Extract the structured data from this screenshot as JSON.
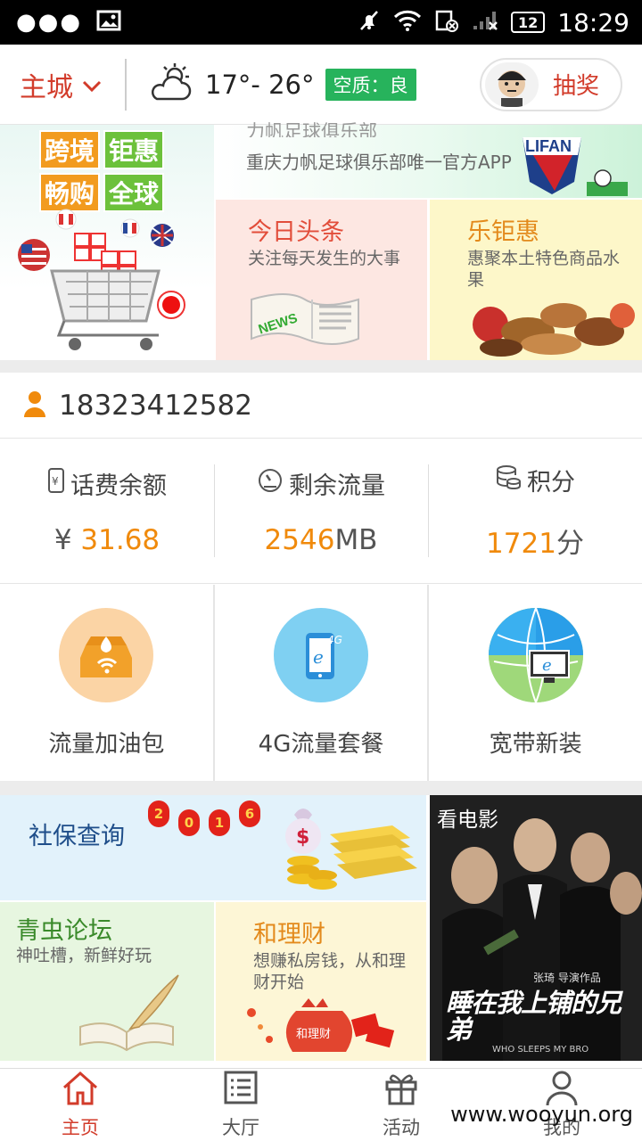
{
  "status_bar": {
    "time": "18:29",
    "battery": "12"
  },
  "header": {
    "city": "主城",
    "temperature": "17°- 26°",
    "air_quality": "空质：良",
    "lottery_label": "抽奖"
  },
  "banners": {
    "crossborder_lines": [
      "跨境",
      "钜惠",
      "畅购",
      "全球"
    ],
    "lifan_title": "力帆足球俱乐部",
    "lifan_subtitle": "重庆力帆足球俱乐部唯一官方APP",
    "lifan_logo": "LIFAN",
    "news_title": "今日头条",
    "news_subtitle": "关注每天发生的大事",
    "news_badge": "NEWS",
    "leju_title": "乐钜惠",
    "leju_subtitle": "惠聚本土特色商品水果"
  },
  "account": {
    "phone": "18323412582"
  },
  "stats": {
    "balance_label": "话费余额",
    "balance_currency": "¥ ",
    "balance_value": "31.68",
    "data_label": "剩余流量",
    "data_value": "2546",
    "data_unit": "MB",
    "points_label": "积分",
    "points_value": "1721",
    "points_unit": "分"
  },
  "services": [
    {
      "label": "流量加油包"
    },
    {
      "label": "4G流量套餐"
    },
    {
      "label": "宽带新装"
    }
  ],
  "promos": {
    "shebao_title": "社保查询",
    "year_lanterns": [
      "2",
      "0",
      "1",
      "6"
    ],
    "qingchong_title": "青虫论坛",
    "qingchong_subtitle": "神吐槽，新鲜好玩",
    "licai_title": "和理财",
    "licai_subtitle": "想赚私房钱，从和理财开始",
    "licai_bag": "和理财",
    "movie_title": "看电影",
    "movie_poster_title": "睡在我上铺的兄弟",
    "movie_credit": "张琦 导演作品",
    "movie_en": "WHO SLEEPS MY BRO"
  },
  "tabs": [
    {
      "label": "主页"
    },
    {
      "label": "大厅"
    },
    {
      "label": "活动"
    },
    {
      "label": "我的"
    }
  ],
  "watermark": "www.wooyun.org",
  "colors": {
    "brand_red": "#d23b2a",
    "accent_orange": "#f08a0c",
    "aqi_green": "#27b35c"
  }
}
